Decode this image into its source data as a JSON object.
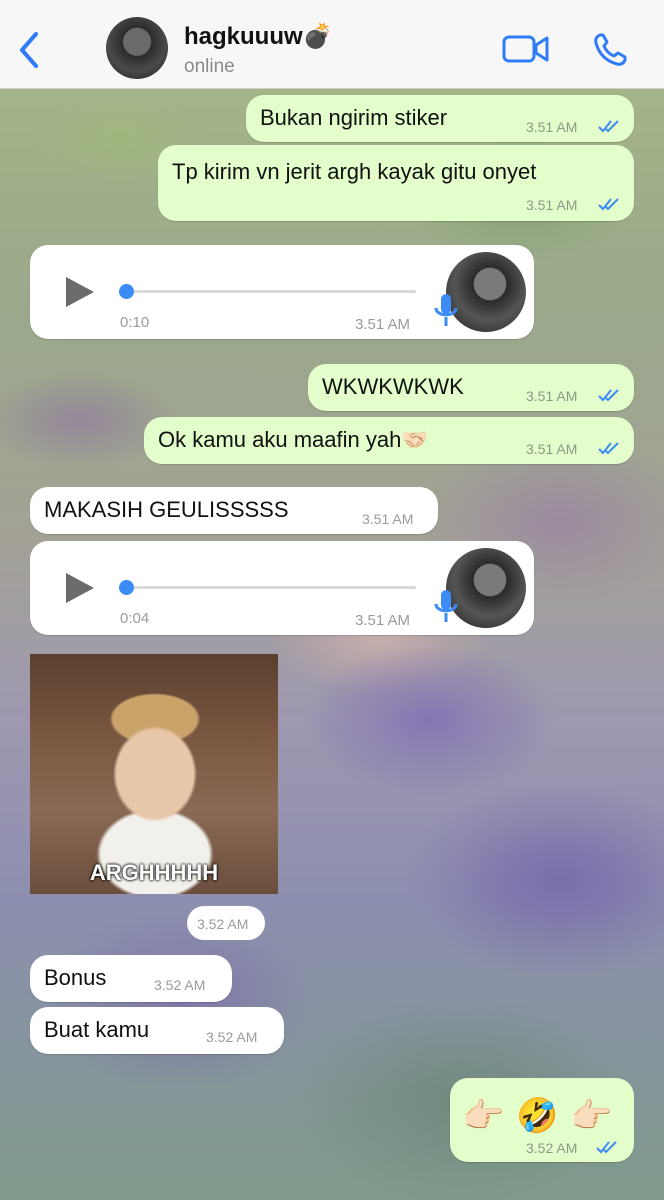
{
  "header": {
    "contact_name": "hagkuuuw💣",
    "status": "online"
  },
  "messages": [
    {
      "text": "Bukan ngirim stiker",
      "time": "3.51 AM"
    },
    {
      "text": "Tp kirim vn jerit argh kayak gitu onyet",
      "time": "3.51 AM"
    },
    {
      "voice_duration": "0:10",
      "time": "3.51 AM"
    },
    {
      "text": "WKWKWKWK",
      "time": "3.51 AM"
    },
    {
      "text": "Ok kamu aku maafin yah🤝🏻",
      "time": "3.51 AM"
    },
    {
      "text": "MAKASIH GEULISSSSS",
      "time": "3.51 AM"
    },
    {
      "voice_duration": "0:04",
      "time": "3.51 AM"
    },
    {
      "sticker_caption": "ARGHHHHH",
      "time": "3.52 AM"
    },
    {
      "text": "Bonus",
      "time": "3.52 AM"
    },
    {
      "text": "Buat kamu",
      "time": "3.52 AM"
    },
    {
      "emojis": [
        "👉🏻",
        "🤣",
        "👉🏻"
      ],
      "time": "3.52 AM"
    }
  ],
  "colors": {
    "outgoing_bubble": "#e3fdcb",
    "incoming_bubble": "#ffffff",
    "accent_blue": "#3b8cf5",
    "header_bg": "#f7f7f7"
  },
  "icons": {
    "back": "chevron-left-icon",
    "video": "video-camera-icon",
    "phone": "phone-icon",
    "play": "play-icon",
    "mic": "microphone-icon",
    "read": "double-check-icon"
  }
}
